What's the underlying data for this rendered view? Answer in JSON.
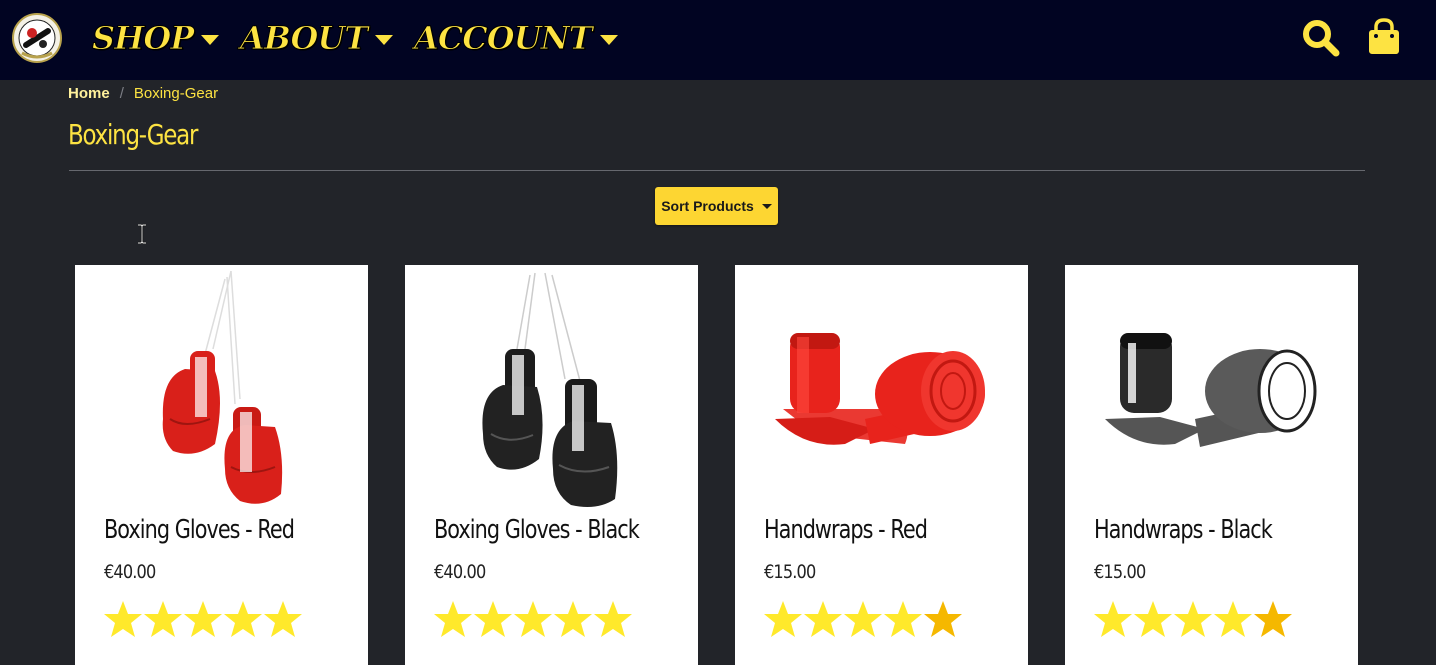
{
  "navbar": {
    "logo": "club-crest-logo",
    "items": [
      {
        "label": "SHOP",
        "icon": "chevron-down-icon"
      },
      {
        "label": "ABOUT",
        "icon": "chevron-down-icon"
      },
      {
        "label": "ACCOUNT",
        "icon": "chevron-down-icon"
      }
    ],
    "icons": [
      "search-icon",
      "shopping-bag-icon"
    ]
  },
  "breadcrumb": {
    "home": "Home",
    "separator": "/",
    "current": "Boxing-Gear"
  },
  "page_title": "Boxing-Gear",
  "sort_button": {
    "label": "Sort Products",
    "icon": "caret-down-icon"
  },
  "products": [
    {
      "title": "Boxing Gloves - Red",
      "price": "€40.00",
      "rating": 5,
      "image": "red-boxing-gloves",
      "color": "#d9201a"
    },
    {
      "title": "Boxing Gloves - Black",
      "price": "€40.00",
      "rating": 5,
      "image": "black-boxing-gloves",
      "color": "#1c1c1c"
    },
    {
      "title": "Handwraps - Red",
      "price": "€15.00",
      "rating": 4.5,
      "image": "red-handwraps",
      "color": "#e8231c"
    },
    {
      "title": "Handwraps - Black",
      "price": "€15.00",
      "rating": 4.5,
      "image": "black-handwraps",
      "color": "#2a2a2a"
    }
  ],
  "colors": {
    "navbar_bg": "#010422",
    "page_bg": "#222429",
    "accent_yellow": "#fde342",
    "button_yellow": "#fdd632",
    "star_yellow": "#ffe92b",
    "star_half": "#f5b800"
  }
}
